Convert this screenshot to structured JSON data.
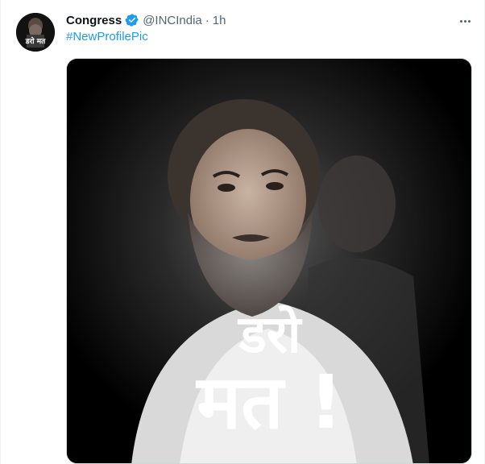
{
  "tweet": {
    "author_name": "Congress",
    "handle": "@INCIndia",
    "separator": "·",
    "time": "1h",
    "hashtag": "#NewProfilePic",
    "avatar_text": "डरो मत",
    "image_text_line1": "डरो",
    "image_text_line2": "मत !"
  },
  "icons": {
    "verified": "verified-badge-icon",
    "more": "more-options-icon"
  },
  "colors": {
    "link": "#1d9bf0",
    "verified": "#1d9bf0",
    "secondary_text": "#536471",
    "image_background": "#000000"
  }
}
